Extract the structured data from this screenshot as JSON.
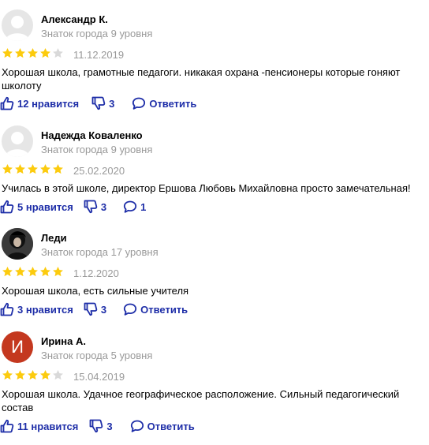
{
  "colors": {
    "link": "#1e2ea8",
    "muted": "#999999",
    "star_on": "#fccb0e",
    "star_off": "#d9d9d9"
  },
  "reviews": [
    {
      "author": "Александр К.",
      "level": "Знаток города 9 уровня",
      "rating": 4,
      "date": "11.12.2019",
      "text": "Хорошая школа, грамотные педагоги. никакая охрана -пенсионеры которые гоняют школоту",
      "likes": "12 нравится",
      "dislikes": "3",
      "comment": "Ответить",
      "avatar": "default-avatar"
    },
    {
      "author": "Надежда Коваленко",
      "level": "Знаток города 9 уровня",
      "rating": 5,
      "date": "25.02.2020",
      "text": "Училась в этой школе, директор Ершова Любовь Михайловна просто замечательная!",
      "likes": "5 нравится",
      "dislikes": "3",
      "comment": "1",
      "avatar": "default-avatar"
    },
    {
      "author": "Леди",
      "level": "Знаток города 17 уровня",
      "rating": 5,
      "date": "1.12.2020",
      "text": "Хорошая школа, есть сильные учителя",
      "likes": "3 нравится",
      "dislikes": "3",
      "comment": "Ответить",
      "avatar": "photo-avatar"
    },
    {
      "author": "Ирина А.",
      "level": "Знаток города 5 уровня",
      "rating": 4,
      "date": "15.04.2019",
      "text": "Хорошая школа. Удачное географическое расположение. Сильный педагогический состав",
      "likes": "11 нравится",
      "dislikes": "3",
      "comment": "Ответить",
      "avatar": "letter-avatar",
      "avatar_letter": "И",
      "avatar_color": "#c4381f"
    }
  ]
}
